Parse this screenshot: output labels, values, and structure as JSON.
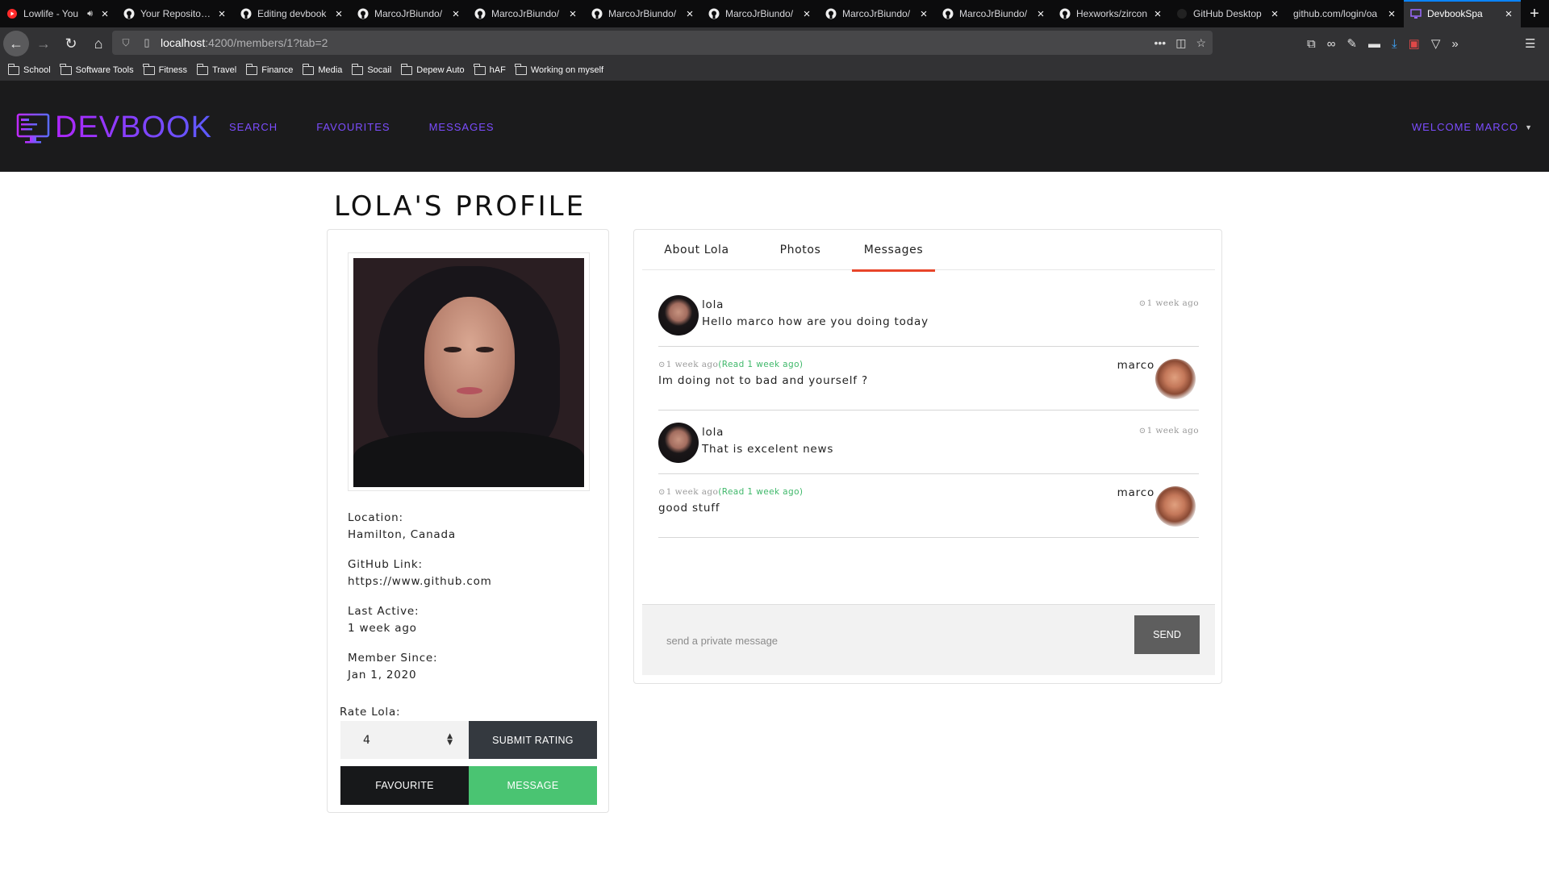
{
  "browser": {
    "tabs": [
      {
        "title": "Lowlife - You",
        "icon": "youtube-icon"
      },
      {
        "title": "Your Repositories",
        "icon": "github-icon"
      },
      {
        "title": "Editing devbook",
        "icon": "github-icon"
      },
      {
        "title": "MarcoJrBiundo/",
        "icon": "github-icon"
      },
      {
        "title": "MarcoJrBiundo/",
        "icon": "github-icon"
      },
      {
        "title": "MarcoJrBiundo/",
        "icon": "github-icon"
      },
      {
        "title": "MarcoJrBiundo/",
        "icon": "github-icon"
      },
      {
        "title": "MarcoJrBiundo/",
        "icon": "github-icon"
      },
      {
        "title": "MarcoJrBiundo/",
        "icon": "github-icon"
      },
      {
        "title": "Hexworks/zircon",
        "icon": "github-icon"
      },
      {
        "title": "GitHub Desktop",
        "icon": "github-desktop-icon"
      },
      {
        "title": "github.com/login/oa",
        "icon": "none"
      },
      {
        "title": "DevbookSpa",
        "icon": "devbook-icon",
        "active": true
      }
    ],
    "url_host": "localhost",
    "url_rest": ":4200/members/1?tab=2",
    "bookmarks": [
      "School",
      "Software Tools",
      "Fitness",
      "Travel",
      "Finance",
      "Media",
      "Socail",
      "Depew Auto",
      "hAF",
      "Working on myself"
    ]
  },
  "app": {
    "brand": "DEVBOOK",
    "nav": [
      "SEARCH",
      "FAVOURITES",
      "MESSAGES"
    ],
    "welcome": "WELCOME MARCO",
    "accent": "#7c4dff"
  },
  "profile": {
    "title": "LOLA'S PROFILE",
    "location_label": "Location:",
    "location": "Hamilton, Canada",
    "github_label": "GitHub Link:",
    "github": "https://www.github.com",
    "last_active_label": "Last Active:",
    "last_active": "1 week ago",
    "member_since_label": "Member Since:",
    "member_since": "Jan 1, 2020",
    "rate_label": "Rate Lola:",
    "rating_value": "4",
    "submit_label": "SUBMIT RATING",
    "favourite_label": "FAVOURITE",
    "message_label": "MESSAGE"
  },
  "tabs": [
    "About Lola",
    "Photos",
    "Messages"
  ],
  "active_tab": "Messages",
  "messages": [
    {
      "sender": "lola",
      "text": "Hello marco how are you doing today",
      "time": "1 week ago",
      "read": ""
    },
    {
      "sender": "marco",
      "text": "Im doing not to bad and yourself ?",
      "time": "1 week ago",
      "read": "(Read 1 week ago)"
    },
    {
      "sender": "lola",
      "text": "That is excelent news",
      "time": "1 week ago",
      "read": ""
    },
    {
      "sender": "marco",
      "text": "good stuff",
      "time": "1 week ago",
      "read": "(Read 1 week ago)"
    }
  ],
  "compose": {
    "placeholder": "send a private message",
    "send_label": "SEND"
  },
  "colors": {
    "header_bg": "#1b1b1c",
    "tab_underline": "#e8452a",
    "message_button": "#4ac472",
    "read_receipt": "#3fb86a"
  }
}
